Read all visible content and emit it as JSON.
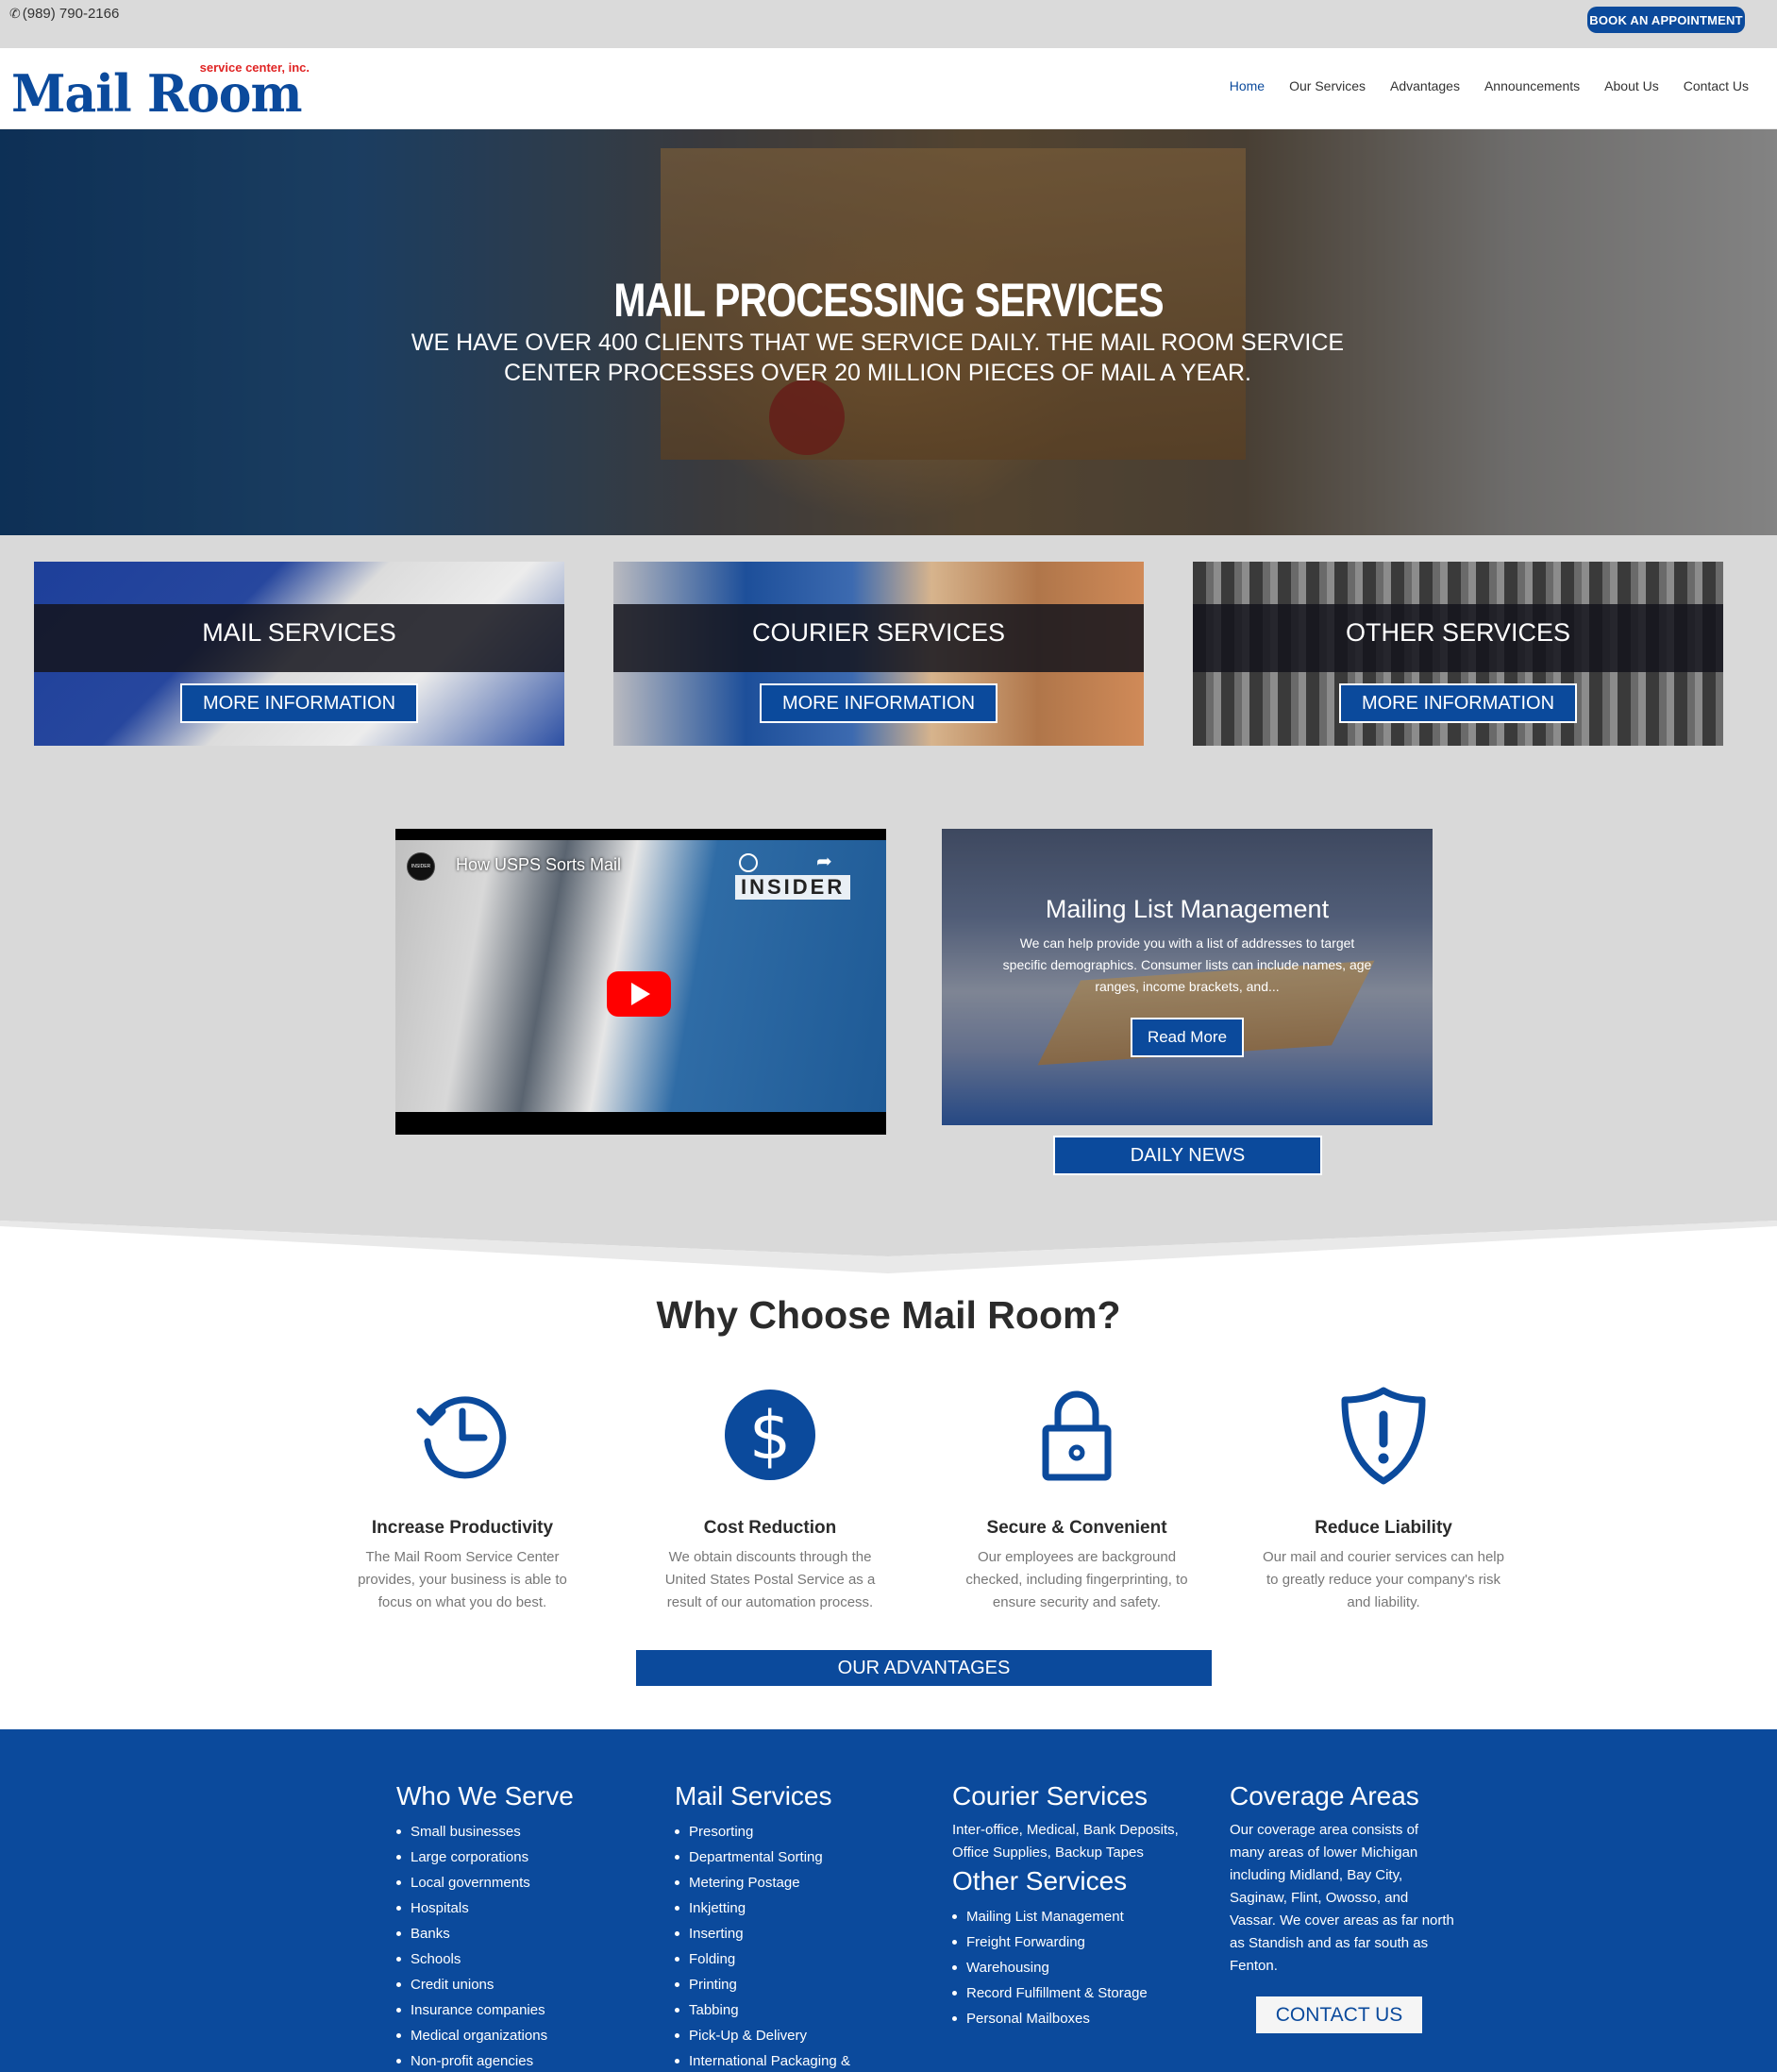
{
  "topbar": {
    "phone": "(989) 790-2166",
    "book_label": "BOOK AN APPOINTMENT"
  },
  "logo": {
    "tagline": "service center, inc.",
    "name": "Mail Room"
  },
  "nav": [
    {
      "label": "Home",
      "active": true
    },
    {
      "label": "Our Services"
    },
    {
      "label": "Advantages"
    },
    {
      "label": "Announcements"
    },
    {
      "label": "About Us"
    },
    {
      "label": "Contact Us"
    }
  ],
  "hero": {
    "title": "MAIL PROCESSING SERVICES",
    "subtitle": "WE HAVE OVER 400 CLIENTS THAT WE SERVICE DAILY. THE MAIL ROOM SERVICE CENTER PROCESSES OVER 20 MILLION PIECES OF MAIL A YEAR."
  },
  "services": [
    {
      "title": "MAIL SERVICES",
      "button": "MORE INFORMATION"
    },
    {
      "title": "COURIER SERVICES",
      "button": "MORE INFORMATION"
    },
    {
      "title": "OTHER SERVICES",
      "button": "MORE INFORMATION"
    }
  ],
  "video": {
    "title": "How USPS Sorts Mail",
    "channel": "INSIDER",
    "channel_logo": "INSIDER"
  },
  "mailing_list": {
    "title": "Mailing List Management",
    "text": "We can help provide you with a list of addresses to target specific demographics. Consumer lists can include names, age ranges, income brackets, and...",
    "button": "Read More"
  },
  "daily_news_label": "DAILY NEWS",
  "why": {
    "title": "Why Choose Mail Room?",
    "features": [
      {
        "icon": "history-clock-icon",
        "title": "Increase Productivity",
        "text": "The Mail Room Service Center provides, your business is able to focus on what you do best."
      },
      {
        "icon": "dollar-icon",
        "title": "Cost Reduction",
        "text": "We obtain discounts through the United States Postal Service as a result of our automation process."
      },
      {
        "icon": "lock-icon",
        "title": "Secure & Convenient",
        "text": "Our employees are background checked, including fingerprinting, to ensure security and safety."
      },
      {
        "icon": "shield-alert-icon",
        "title": "Reduce Liability",
        "text": "Our mail and courier services can help to greatly reduce your company's risk and liability."
      }
    ],
    "button": "OUR ADVANTAGES"
  },
  "footer": {
    "who": {
      "title": "Who We Serve",
      "items": [
        "Small businesses",
        "Large corporations",
        "Local governments",
        "Hospitals",
        "Banks",
        "Schools",
        "Credit unions",
        "Insurance companies",
        "Medical organizations",
        "Non-profit agencies"
      ]
    },
    "mail": {
      "title": "Mail Services",
      "items": [
        "Presorting",
        "Departmental Sorting",
        "Metering Postage",
        "Inkjetting",
        "Inserting",
        "Folding",
        "Printing",
        "Tabbing",
        "Pick-Up & Delivery",
        "International Packaging &"
      ]
    },
    "courier": {
      "title": "Courier Services",
      "text": "Inter-office, Medical, Bank Deposits, Office Supplies, Backup Tapes"
    },
    "other": {
      "title": "Other Services",
      "items": [
        "Mailing List Management",
        "Freight Forwarding",
        "Warehousing",
        "Record Fulfillment  & Storage",
        "Personal Mailboxes"
      ]
    },
    "coverage": {
      "title": "Coverage Areas",
      "text": "Our coverage area consists of many areas of lower Michigan including Midland, Bay City, Saginaw, Flint, Owosso, and Vassar. We cover areas as far north as Standish and as far south as Fenton.",
      "button": "CONTACT US"
    }
  },
  "colors": {
    "brand_blue": "#0b4a9c",
    "accent_red": "#e02424",
    "band_gray": "#d9d9d9"
  }
}
